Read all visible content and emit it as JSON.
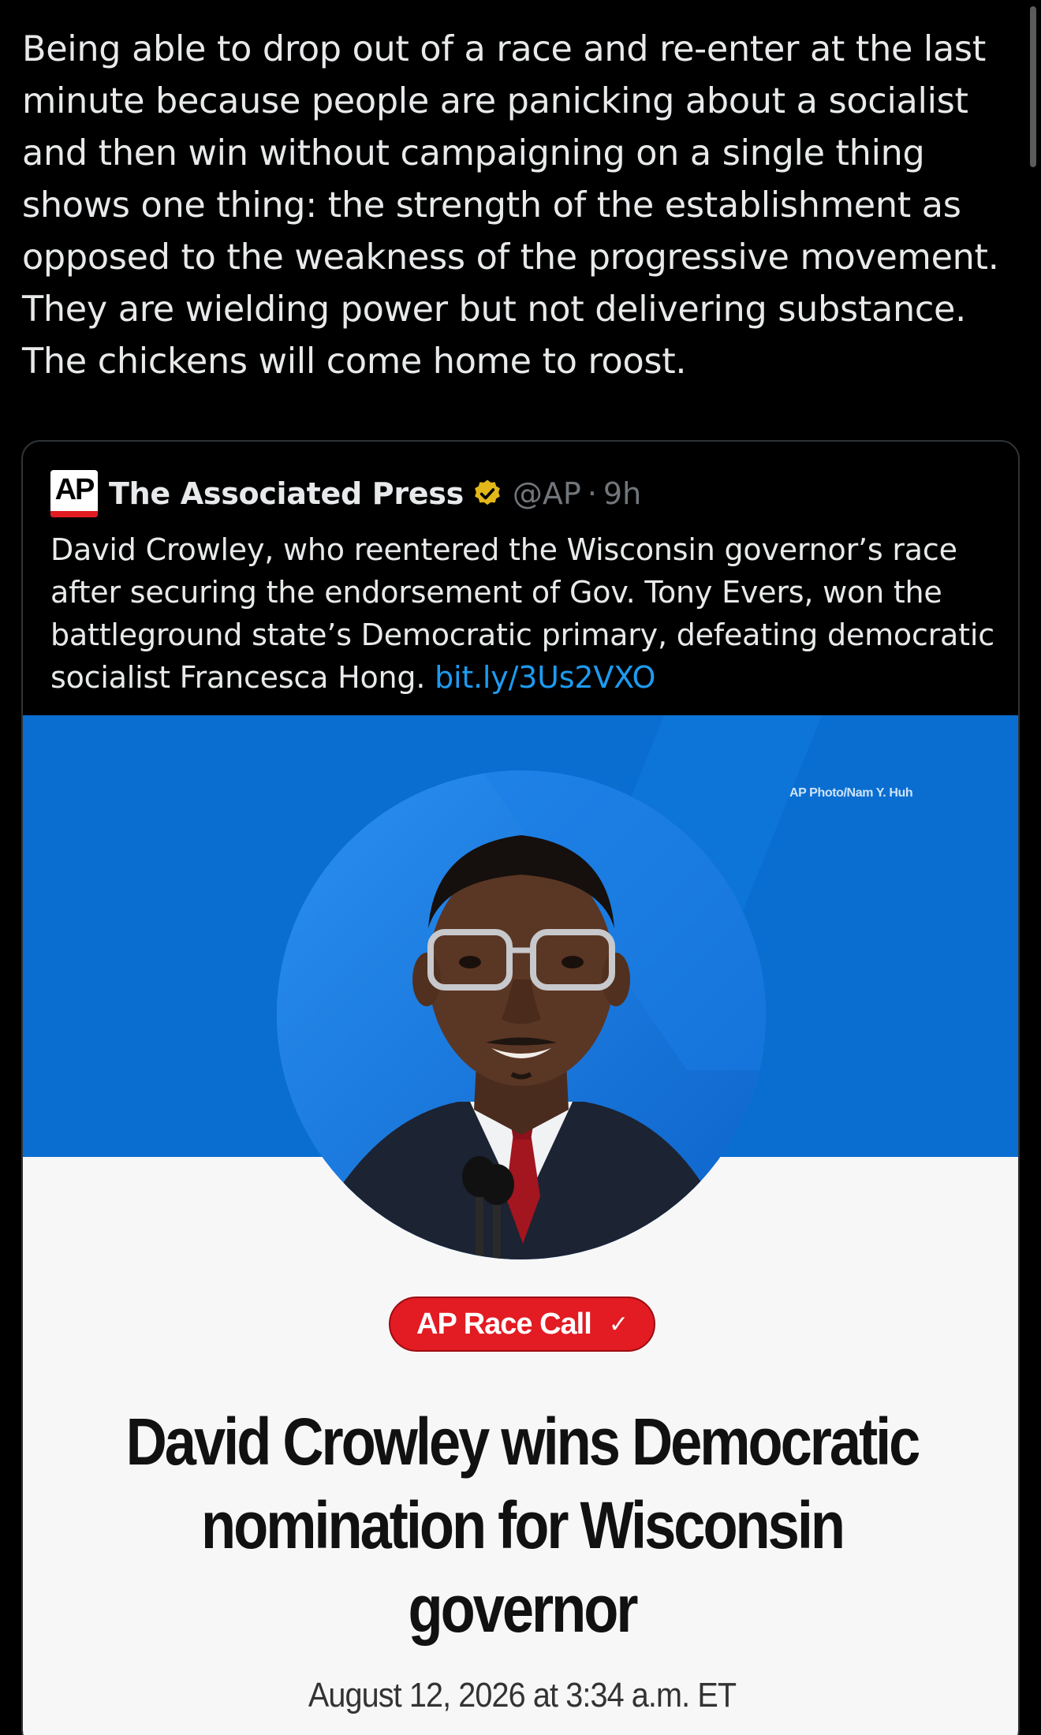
{
  "tweet": {
    "text": "Being able to drop out of a race and re-enter at the last minute because people are panicking about a socialist and then win without campaigning on a single thing shows one thing: the strength of the establishment as opposed to the weakness of the progressive movement. They are wielding power but not delivering substance. The chickens will come home to roost."
  },
  "quote": {
    "logo_text": "AP",
    "author_name": "The Associated Press",
    "handle": "@AP",
    "separator": "·",
    "time": "9h",
    "text": "David Crowley, who reentered the Wisconsin governor’s race after securing the endorsement of Gov. Tony Evers, won the battleground state’s Democratic primary, defeating democratic socialist Francesca Hong. ",
    "link": "bit.ly/3Us2VXO",
    "verified_icon": "verified-gold-badge-icon"
  },
  "card": {
    "photo_credit": "AP Photo/Nam Y. Huh",
    "badge_label": "AP Race Call",
    "badge_check": "✓",
    "headline": "David Crowley wins Democratic nomination for Wisconsin governor",
    "dateline": "August 12, 2026 at 3:34 a.m. ET"
  },
  "colors": {
    "background": "#000000",
    "link": "#1d9bf0",
    "ap_red": "#e31b23",
    "card_blue": "#0a6ed1",
    "verified_gold": "#e2b719"
  }
}
